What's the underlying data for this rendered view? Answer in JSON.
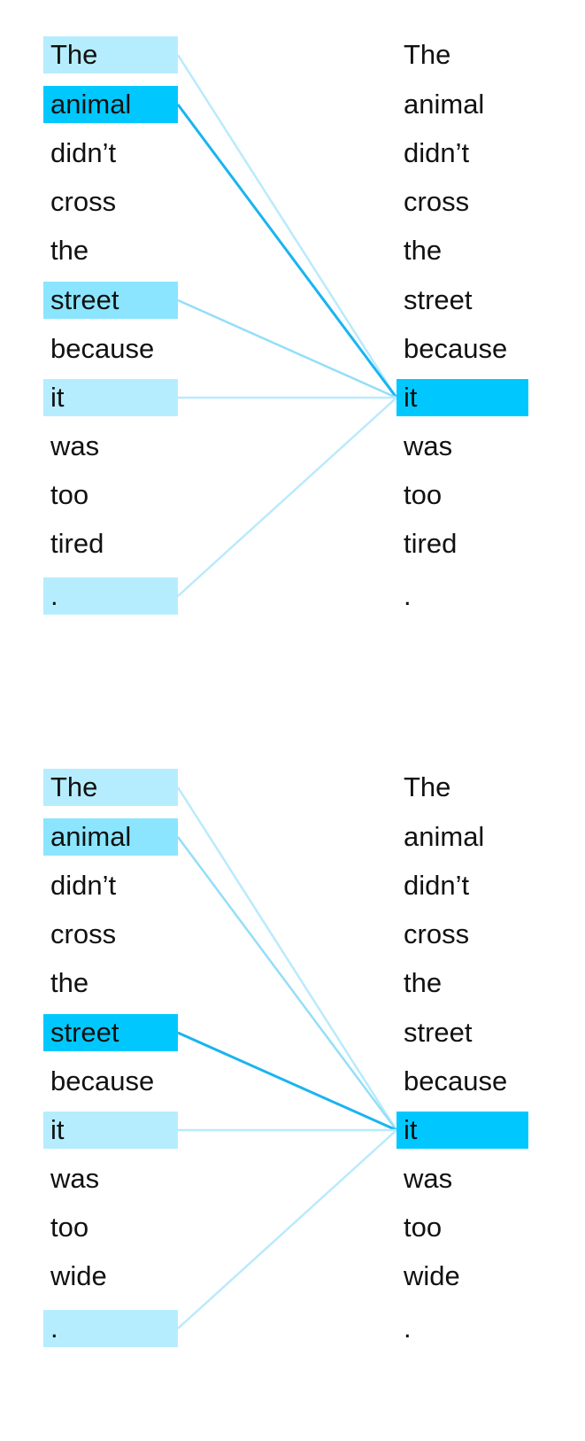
{
  "diagrams": [
    {
      "left_tokens": [
        "The",
        "animal",
        "didn’t",
        "cross",
        "the",
        "street",
        "because",
        "it",
        "was",
        "too",
        "tired",
        "."
      ],
      "right_tokens": [
        "The",
        "animal",
        "didn’t",
        "cross",
        "the",
        "street",
        "because",
        "it",
        "was",
        "too",
        "tired",
        "."
      ],
      "query_index": 7,
      "attention": [
        {
          "from": 0,
          "weight": 0.15
        },
        {
          "from": 1,
          "weight": 1.0
        },
        {
          "from": 5,
          "weight": 0.35
        },
        {
          "from": 7,
          "weight": 0.15
        },
        {
          "from": 11,
          "weight": 0.15
        }
      ]
    },
    {
      "left_tokens": [
        "The",
        "animal",
        "didn’t",
        "cross",
        "the",
        "street",
        "because",
        "it",
        "was",
        "too",
        "wide",
        "."
      ],
      "right_tokens": [
        "The",
        "animal",
        "didn’t",
        "cross",
        "the",
        "street",
        "because",
        "it",
        "was",
        "too",
        "wide",
        "."
      ],
      "query_index": 7,
      "attention": [
        {
          "from": 0,
          "weight": 0.15
        },
        {
          "from": 1,
          "weight": 0.35
        },
        {
          "from": 5,
          "weight": 1.0
        },
        {
          "from": 7,
          "weight": 0.15
        },
        {
          "from": 11,
          "weight": 0.15
        }
      ]
    }
  ],
  "colors": {
    "accent": "#00c8ff",
    "accent_line": "#1ab4f0",
    "text": "#111111"
  }
}
